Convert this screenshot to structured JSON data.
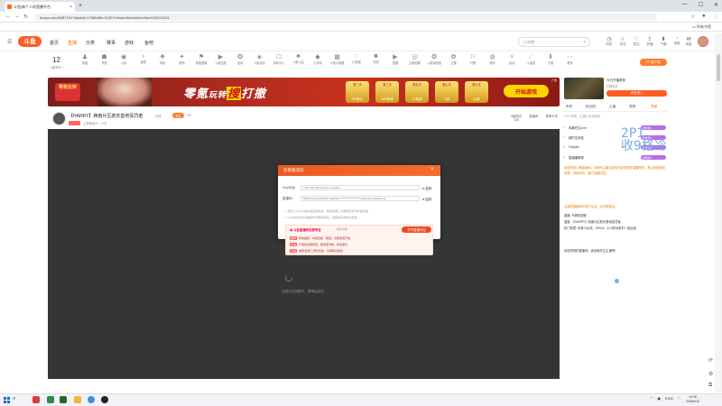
{
  "browser": {
    "tab_title": "斗鱼|每个人的直播平台",
    "new_tab": "+",
    "address": "douyu.com/9487101?dyshid=1766b88e-91427e1bdec9de4b2ecb3ee1000211101",
    "bookmarks": "所有书签",
    "win_min": "—",
    "win_max": "☐",
    "win_close": "✕"
  },
  "site": {
    "logo": "斗鱼",
    "nav": [
      "首页",
      "直播",
      "分类",
      "赛事",
      "游戏",
      "鱼吧"
    ],
    "search_placeholder": "日本稿",
    "header_icons": [
      {
        "icon": "clock-icon",
        "glyph": "◷",
        "label": "历史"
      },
      {
        "icon": "star-icon",
        "glyph": "☆",
        "label": "关注"
      },
      {
        "icon": "heart-icon",
        "glyph": "♡",
        "label": "关注"
      },
      {
        "icon": "upload-icon",
        "glyph": "⇪",
        "label": "开播"
      },
      {
        "icon": "download-icon",
        "glyph": "⬇",
        "label": "下载"
      },
      {
        "icon": "bell-icon",
        "glyph": "🔔",
        "label": "消息"
      },
      {
        "icon": "gift-icon",
        "glyph": "✉",
        "label": "消息"
      },
      {
        "icon": "crown-icon",
        "glyph": "♛",
        "label": "任务"
      }
    ],
    "date_day": "12",
    "date_sub": "斗鱼年订一",
    "categories": [
      "鱼塘",
      "专属",
      "斗鱼",
      "星眼",
      "特权",
      "推特",
      "英雄直播",
      "斗鱼回放",
      "活动",
      "斗鱼商店",
      "游戏中心",
      "斗鱼公益",
      "小游戏",
      "斗鱼计算器",
      "小鱼塘",
      "在线",
      "直播",
      "主播招募",
      "斗鱼体验馆",
      "主播",
      "开黑",
      "特别",
      "活动",
      "斗鱼星",
      "下载",
      "更多"
    ],
    "pc_button": "PC客户端"
  },
  "ad": {
    "game": "零氪玩转",
    "headline_a": "零氪",
    "headline_b": "玩转",
    "headline_c": "搜",
    "headline_d": "打撤",
    "prizes": [
      {
        "top": "第三天",
        "bottom": "2W鱼丸"
      },
      {
        "top": "第三天",
        "bottom": "500鱼翅"
      },
      {
        "top": "第五天",
        "bottom": "20鱼翅"
      },
      {
        "top": "第七天",
        "bottom": "飞机"
      },
      {
        "top": "第七天",
        "bottom": "火箭"
      }
    ],
    "start": "开始游戏",
    "tag": "广告",
    "side_title": "今日开播推荐",
    "side_sub": "打野高手",
    "side_btn": "点击进入"
  },
  "room": {
    "title": "【HARRY】西南片区航天基地惩罚者",
    "tag": "在线",
    "follow": "关注",
    "num": "987",
    "sub": "主播等级29 · 分享",
    "tools": [
      {
        "label": "5级粉丝",
        "value": "135"
      },
      {
        "label": "直播间"
      },
      {
        "label": "赛季分享"
      }
    ]
  },
  "player": {
    "loading": "当前正在加载中，请稍后尝试"
  },
  "dialog": {
    "title": "获取推流码",
    "rtmp_label": "rtmp地址：",
    "rtmp_value": "rtmp://sendtc3.douyu.com/live",
    "key_label": "直播码：",
    "key_value": "9487101rluuTkNzHxTqjVPkc*******************7c8codec=gs&tokenr",
    "copy": "复制",
    "note1": "1. 复制上方rtmp地址和直播码后，粘贴到第三方推流软件中开始直播",
    "note2": "2. rtmp地址仅在当前操作流程内有效，直播码仅限本次使用",
    "promo_title": "斗鱼直播伴侣更专业",
    "promo_sub": "更多功能",
    "open_pc": "打开直播伴侣",
    "lines": [
      {
        "tag": "推荐",
        "text": "特效美颜，本地直播「美颜」功能免费开放"
      },
      {
        "tag": "加速",
        "text": "升级的直播伴侣，推流更清晰，体验更好"
      },
      {
        "tag": "开播",
        "text": "横屏/竖屏三场景切换，无需再次授权"
      }
    ]
  },
  "right": {
    "tabs": [
      "贵宾",
      "粉丝团",
      "主播",
      "周榜",
      "贡献"
    ],
    "header": "1-60 周榜 - 主播礼物贡献值",
    "ranks": [
      {
        "num": "1",
        "name": "风暴先生love",
        "badge": "赛季榜1"
      },
      {
        "num": "2",
        "name": "超时空伊娃",
        "badge": "赛季榜2"
      },
      {
        "num": "3",
        "name": "Guryaki",
        "badge": "赛季榜3"
      },
      {
        "num": "4",
        "name": "直播编辑部",
        "badge": "赛季榜4"
      }
    ],
    "watermark": "2P1\n收9格冷",
    "chat": [
      "欢迎来到斗鱼直播间，本房间主播与游戏内容须遵守直播规范，禁止传播违法违规、低俗色情、暴力血腥内容。",
      "主播的直播间为官方认证，请文明发言。",
      "直播: 乌斯特提新",
      "温馨: 【HARRY】西南片区航天基地惩罚者",
      "热门标签: 玩家小伙伴、3Fw-8、41.5的玩家们一起加油",
      "",
      "欢迎来到的直播间，喜欢就关注主播吧！"
    ]
  },
  "taskbar": {
    "tray": "ENG",
    "time": "14:35",
    "date": "2025/4/12"
  }
}
